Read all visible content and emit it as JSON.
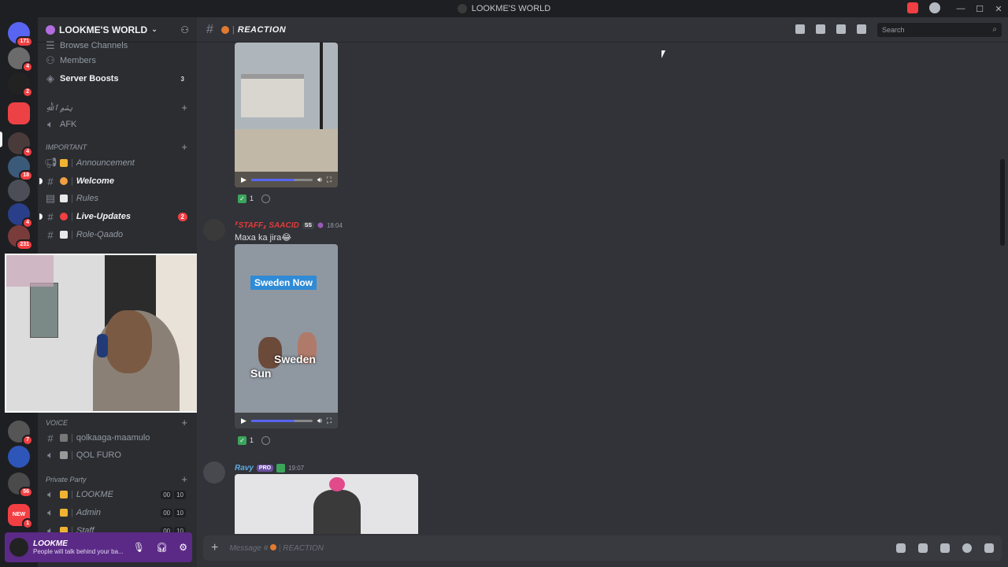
{
  "window": {
    "title": "LOOKME'S WORLD"
  },
  "server": {
    "name": "LOOKME'S WORLD"
  },
  "rail": {
    "badges": [
      "171",
      "4",
      "2",
      "4",
      "18",
      "4",
      "4",
      "231",
      "7",
      "56",
      "1"
    ],
    "new_label": "NEW"
  },
  "sidebar": {
    "items": [
      {
        "label": "Browse Channels"
      },
      {
        "label": "Members"
      },
      {
        "label": "Server Boosts",
        "count": "3"
      }
    ],
    "categories": {
      "arabic": "بِسْمِ ٱللَّٰهِ",
      "important": "IMPORTANT",
      "voice": "VOICE",
      "private": "Private Party"
    },
    "afk": "AFK",
    "important_channels": [
      {
        "label": "Announcement"
      },
      {
        "label": "Welcome"
      },
      {
        "label": "Rules"
      },
      {
        "label": "Live-Updates",
        "count": "2"
      },
      {
        "label": "Role-Qaado"
      }
    ],
    "voice_channels": [
      {
        "label": "qolkaaga-maamulo"
      },
      {
        "label": "QOL FURO"
      }
    ],
    "private_channels": [
      {
        "label": "LOOKME",
        "a": "00",
        "b": "10"
      },
      {
        "label": "Admin",
        "a": "00",
        "b": "10"
      },
      {
        "label": "Staff",
        "a": "00",
        "b": "10"
      }
    ]
  },
  "user": {
    "name": "LOOKME",
    "status": "People will talk behind your ba..."
  },
  "channel": {
    "name": "REACTION"
  },
  "search": {
    "placeholder": "Search"
  },
  "messages": [
    {
      "reaction_count": "1"
    },
    {
      "author": "⸢STAFF⸥ SAACID",
      "tag": "SS",
      "time": "18:04",
      "text": "Maxa ka jira😂",
      "video_caption_top": "Sweden Now",
      "video_caption_mid": "Sweden",
      "video_caption_low": "Sun",
      "reaction_count": "1"
    },
    {
      "author": "Ravy",
      "tag": "PRO",
      "time": "19:07"
    }
  ],
  "composer": {
    "placeholder": "Message #",
    "channel": "REACTION"
  }
}
